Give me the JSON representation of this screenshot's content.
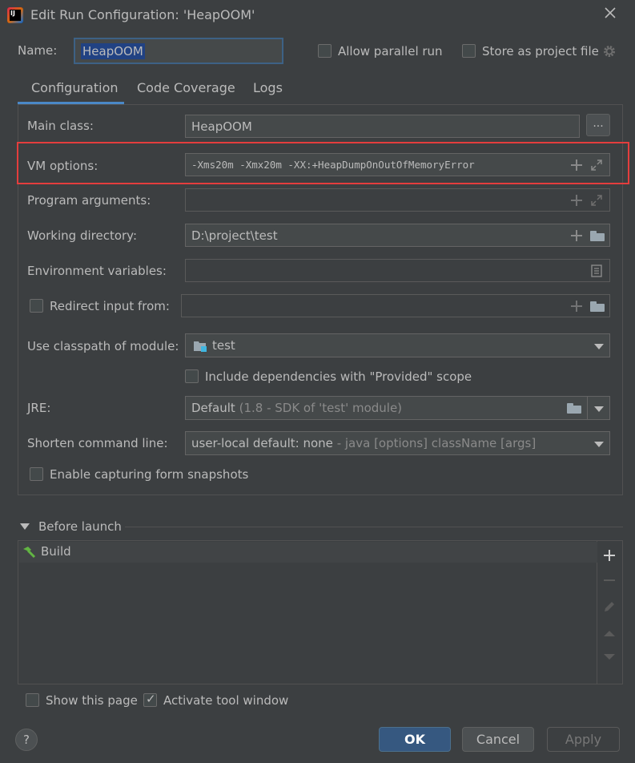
{
  "window": {
    "title": "Edit Run Configuration: 'HeapOOM'",
    "app_icon": "intellij-icon",
    "app_icon_text": "IJ"
  },
  "header": {
    "name_label": "Name:",
    "name_value": "HeapOOM",
    "allow_parallel_label": "Allow parallel run",
    "allow_parallel_checked": false,
    "store_project_label": "Store as project file",
    "store_project_checked": false
  },
  "tabs": [
    {
      "label": "Configuration",
      "active": true
    },
    {
      "label": "Code Coverage",
      "active": false
    },
    {
      "label": "Logs",
      "active": false
    }
  ],
  "form": {
    "main_class_label": "Main class:",
    "main_class_value": "HeapOOM",
    "browse_label": "...",
    "vm_options_label": "VM options:",
    "vm_options_value": "-Xms20m -Xmx20m -XX:+HeapDumpOnOutOfMemoryError",
    "program_args_label": "Program arguments:",
    "program_args_value": "",
    "working_dir_label": "Working directory:",
    "working_dir_value": "D:\\project\\test",
    "env_vars_label": "Environment variables:",
    "env_vars_value": "",
    "redirect_input_label": "Redirect input from:",
    "redirect_input_checked": false,
    "classpath_label": "Use classpath of module:",
    "classpath_value": "test",
    "include_deps_label": "Include dependencies with \"Provided\" scope",
    "include_deps_checked": false,
    "jre_label": "JRE:",
    "jre_value": "Default",
    "jre_hint": "(1.8 - SDK of 'test' module)",
    "shorten_label": "Shorten command line:",
    "shorten_value": "user-local default: none",
    "shorten_hint": "- java [options] className [args]",
    "snapshots_label": "Enable capturing form snapshots",
    "snapshots_checked": false
  },
  "before_launch": {
    "title": "Before launch",
    "items": [
      {
        "label": "Build",
        "icon": "hammer-icon"
      }
    ]
  },
  "footer": {
    "show_page_label": "Show this page",
    "show_page_checked": false,
    "activate_tool_label": "Activate tool window",
    "activate_tool_checked": true,
    "help_label": "?",
    "ok_label": "OK",
    "cancel_label": "Cancel",
    "apply_label": "Apply"
  },
  "colors": {
    "background": "#3c3f41",
    "accent": "#4a88c7",
    "highlight_border": "#e43d3d",
    "ok_button": "#365880"
  }
}
